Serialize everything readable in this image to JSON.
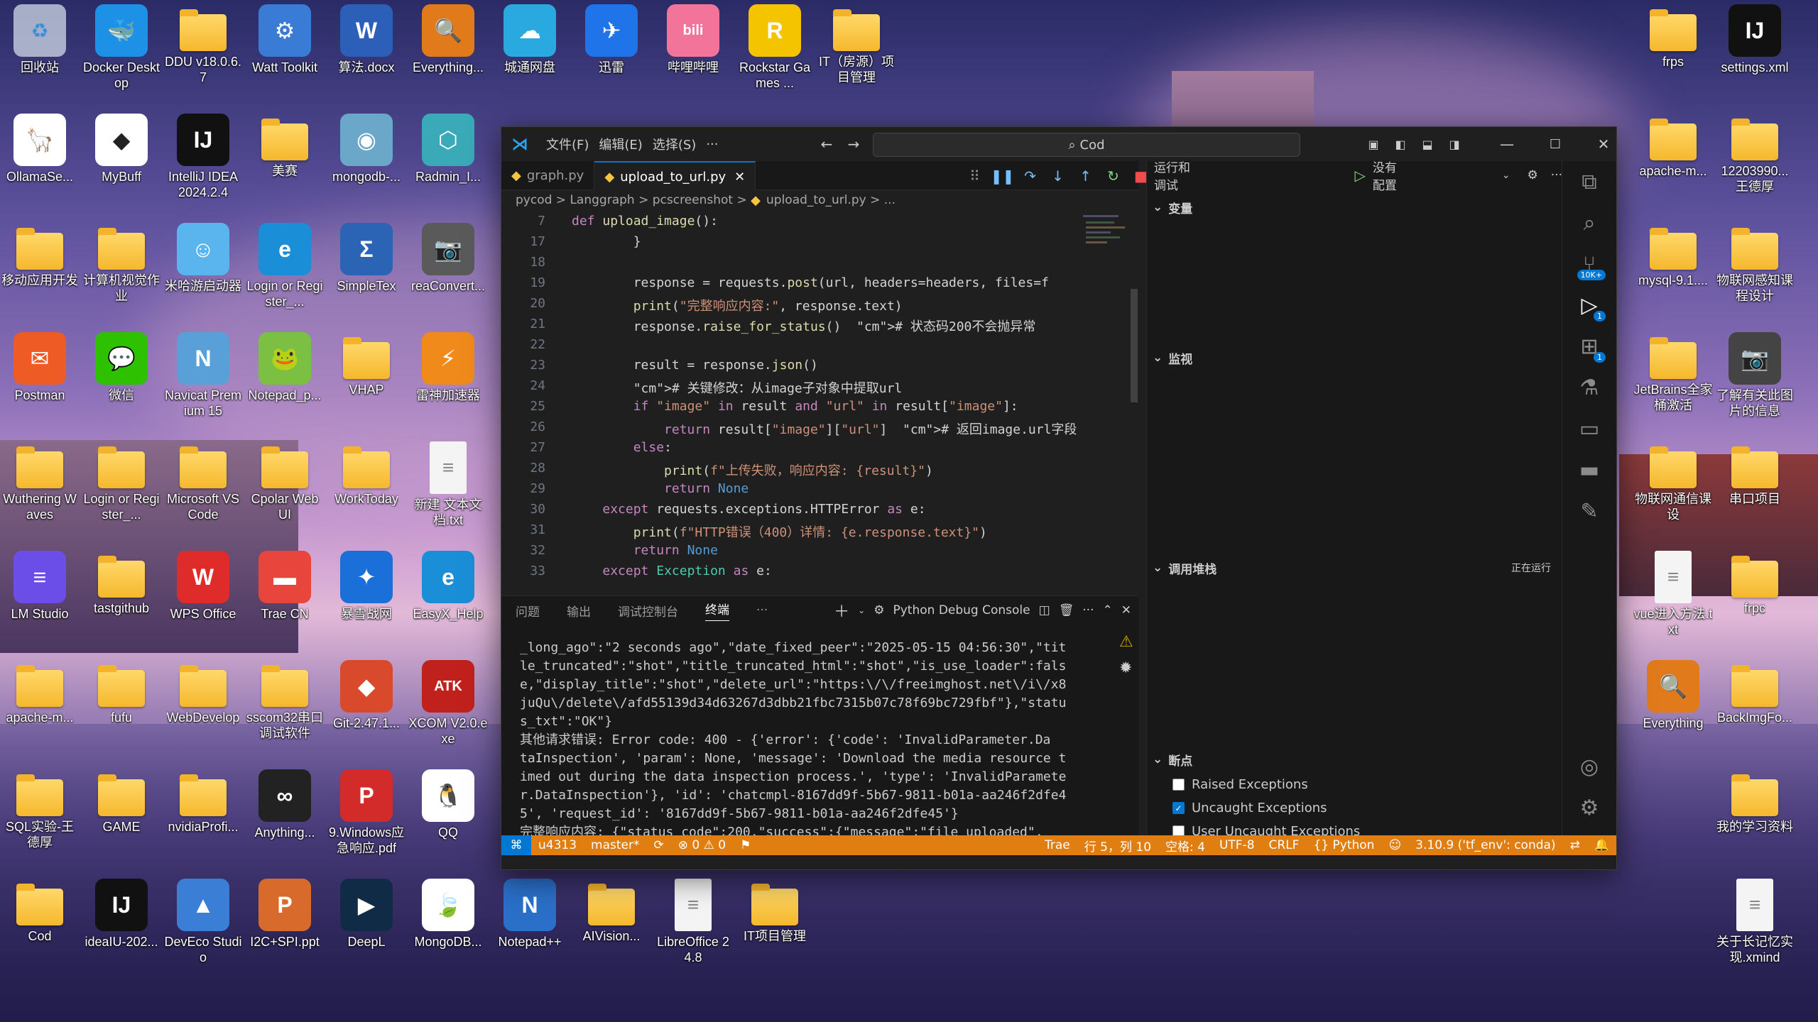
{
  "desktop": {
    "icons_left": [
      {
        "label": "回收站",
        "kind": "bin",
        "col": 0,
        "row": 0
      },
      {
        "label": "Docker Desktop",
        "kind": "app",
        "color": "#1d91e6",
        "glyph": "🐳",
        "col": 1,
        "row": 0
      },
      {
        "label": "DDU v18.0.6.7",
        "kind": "folder",
        "col": 2,
        "row": 0
      },
      {
        "label": "Watt Toolkit",
        "kind": "app",
        "color": "#3a7bd5",
        "glyph": "⚙",
        "col": 3,
        "row": 0
      },
      {
        "label": "算法.docx",
        "kind": "app",
        "color": "#2b5fb8",
        "glyph": "W",
        "col": 4,
        "row": 0
      },
      {
        "label": "Everything...",
        "kind": "app",
        "color": "#e07a1a",
        "glyph": "🔍",
        "col": 5,
        "row": 0
      },
      {
        "label": "城通网盘",
        "kind": "app",
        "color": "#2aa8e0",
        "glyph": "☁",
        "col": 6,
        "row": 0
      },
      {
        "label": "迅雷",
        "kind": "app",
        "color": "#1e74e8",
        "glyph": "✈",
        "col": 7,
        "row": 0
      },
      {
        "label": "哔哩哔哩",
        "kind": "app",
        "color": "#f2749a",
        "glyph": "bili",
        "col": 8,
        "row": 0
      },
      {
        "label": "Rockstar Games ...",
        "kind": "app",
        "color": "#f5c400",
        "glyph": "R",
        "col": 9,
        "row": 0
      },
      {
        "label": "IT（房源）项目管理",
        "kind": "folder",
        "col": 10,
        "row": 0
      },
      {
        "label": "OllamaSe...",
        "kind": "app",
        "color": "#ffffff",
        "glyph": "🦙",
        "col": 0,
        "row": 1
      },
      {
        "label": "MyBuff",
        "kind": "app",
        "color": "#ffffff",
        "glyph": "◆",
        "col": 1,
        "row": 1
      },
      {
        "label": "IntelliJ IDEA 2024.2.4",
        "kind": "app",
        "color": "#111",
        "glyph": "IJ",
        "col": 2,
        "row": 1
      },
      {
        "label": "美赛",
        "kind": "folder",
        "col": 3,
        "row": 1
      },
      {
        "label": "mongodb-...",
        "kind": "app",
        "color": "#6aa7c8",
        "glyph": "◉",
        "col": 4,
        "row": 1
      },
      {
        "label": "Radmin_I...",
        "kind": "app",
        "color": "#3aa9b8",
        "glyph": "⬡",
        "col": 5,
        "row": 1
      },
      {
        "label": "移动应用开发",
        "kind": "folder",
        "col": 0,
        "row": 2
      },
      {
        "label": "计算机视觉作业",
        "kind": "folder",
        "col": 1,
        "row": 2
      },
      {
        "label": "米哈游启动器",
        "kind": "app",
        "color": "#5ab4ee",
        "glyph": "☺",
        "col": 2,
        "row": 2
      },
      {
        "label": "Login or Register_...",
        "kind": "app",
        "color": "#1a8fd8",
        "glyph": "e",
        "col": 3,
        "row": 2
      },
      {
        "label": "SimpleTex",
        "kind": "app",
        "color": "#2b63b5",
        "glyph": "Σ",
        "col": 4,
        "row": 2
      },
      {
        "label": "reaConvert...",
        "kind": "app",
        "color": "#5a5a5a",
        "glyph": "📷",
        "col": 5,
        "row": 2
      },
      {
        "label": "Postman",
        "kind": "app",
        "color": "#ef5b25",
        "glyph": "✉",
        "col": 0,
        "row": 3
      },
      {
        "label": "微信",
        "kind": "app",
        "color": "#2dc100",
        "glyph": "💬",
        "col": 1,
        "row": 3
      },
      {
        "label": "Navicat Premium 15",
        "kind": "app",
        "color": "#5aa0d8",
        "glyph": "N",
        "col": 2,
        "row": 3
      },
      {
        "label": "Notepad_p...",
        "kind": "app",
        "color": "#7bc043",
        "glyph": "🐸",
        "col": 3,
        "row": 3
      },
      {
        "label": "VHAP",
        "kind": "folder",
        "col": 4,
        "row": 3
      },
      {
        "label": "雷神加速器",
        "kind": "app",
        "color": "#f08a1a",
        "glyph": "⚡",
        "col": 5,
        "row": 3
      },
      {
        "label": "Wuthering Waves",
        "kind": "folder",
        "col": 0,
        "row": 4
      },
      {
        "label": "Login or Register_...",
        "kind": "folder",
        "col": 1,
        "row": 4
      },
      {
        "label": "Microsoft VS Code",
        "kind": "folder",
        "col": 2,
        "row": 4
      },
      {
        "label": "Cpolar Web UI",
        "kind": "folder",
        "col": 3,
        "row": 4
      },
      {
        "label": "WorkToday",
        "kind": "folder",
        "col": 4,
        "row": 4
      },
      {
        "label": "新建 文本文档.txt",
        "kind": "doc",
        "col": 5,
        "row": 4
      },
      {
        "label": "LM Studio",
        "kind": "app",
        "color": "#6b4ee8",
        "glyph": "≡",
        "col": 0,
        "row": 5
      },
      {
        "label": "tastgithub",
        "kind": "folder",
        "col": 1,
        "row": 5
      },
      {
        "label": "WPS Office",
        "kind": "app",
        "color": "#e02b2b",
        "glyph": "W",
        "col": 2,
        "row": 5
      },
      {
        "label": "Trae CN",
        "kind": "app",
        "color": "#e8453c",
        "glyph": "▬",
        "col": 3,
        "row": 5
      },
      {
        "label": "暴雪战网",
        "kind": "app",
        "color": "#1a6fd8",
        "glyph": "✦",
        "col": 4,
        "row": 5
      },
      {
        "label": "EasyX_Help",
        "kind": "app",
        "color": "#1a8fd8",
        "glyph": "e",
        "col": 5,
        "row": 5
      },
      {
        "label": "apache-m...",
        "kind": "folder",
        "col": 0,
        "row": 6
      },
      {
        "label": "fufu",
        "kind": "folder",
        "col": 1,
        "row": 6
      },
      {
        "label": "WebDevelop",
        "kind": "folder",
        "col": 2,
        "row": 6
      },
      {
        "label": "sscom32串口调试软件",
        "kind": "folder",
        "col": 3,
        "row": 6
      },
      {
        "label": "Git-2.47.1...",
        "kind": "app",
        "color": "#d84a2b",
        "glyph": "◆",
        "col": 4,
        "row": 6
      },
      {
        "label": "XCOM V2.0.exe",
        "kind": "app",
        "color": "#c0211c",
        "glyph": "ATK",
        "col": 5,
        "row": 6
      },
      {
        "label": "SQL实验-王德厚",
        "kind": "folder",
        "col": 0,
        "row": 7
      },
      {
        "label": "GAME",
        "kind": "folder",
        "col": 1,
        "row": 7
      },
      {
        "label": "nvidiaProfi...",
        "kind": "folder",
        "col": 2,
        "row": 7
      },
      {
        "label": "Anything...",
        "kind": "app",
        "color": "#222",
        "glyph": "∞",
        "col": 3,
        "row": 7
      },
      {
        "label": "9.Windows应急响应.pdf",
        "kind": "app",
        "color": "#d32a2a",
        "glyph": "P",
        "col": 4,
        "row": 7
      },
      {
        "label": "QQ",
        "kind": "app",
        "color": "#ffffff",
        "glyph": "🐧",
        "col": 5,
        "row": 7
      },
      {
        "label": "Cod",
        "kind": "folder",
        "col": 0,
        "row": 8
      },
      {
        "label": "ideaIU-202...",
        "kind": "app",
        "color": "#111",
        "glyph": "IJ",
        "col": 1,
        "row": 8
      },
      {
        "label": "DevEco Studio",
        "kind": "app",
        "color": "#3a7fd5",
        "glyph": "▲",
        "col": 2,
        "row": 8
      },
      {
        "label": "I2C+SPI.ppt",
        "kind": "app",
        "color": "#d86a2b",
        "glyph": "P",
        "col": 3,
        "row": 8
      },
      {
        "label": "DeepL",
        "kind": "app",
        "color": "#0f2b46",
        "glyph": "▶",
        "col": 4,
        "row": 8
      },
      {
        "label": "MongoDB...",
        "kind": "app",
        "color": "#fff",
        "glyph": "🍃",
        "col": 5,
        "row": 8
      },
      {
        "label": "Notepad++",
        "kind": "app",
        "color": "#2a6fc8",
        "glyph": "N",
        "col": 6,
        "row": 8
      },
      {
        "label": "AIVision...",
        "kind": "folder",
        "col": 7,
        "row": 8
      },
      {
        "label": "LibreOffice 24.8",
        "kind": "doc",
        "col": 8,
        "row": 8
      },
      {
        "label": "IT项目管理",
        "kind": "folder",
        "col": 9,
        "row": 8
      }
    ],
    "icons_right": [
      {
        "label": "frps",
        "kind": "folder",
        "col": 0,
        "row": 0
      },
      {
        "label": "settings.xml",
        "kind": "app",
        "color": "#111",
        "glyph": "IJ",
        "col": 1,
        "row": 0
      },
      {
        "label": "apache-m...",
        "kind": "folder",
        "col": 0,
        "row": 1
      },
      {
        "label": "12203990...王德厚",
        "kind": "folder",
        "col": 1,
        "row": 1
      },
      {
        "label": "mysql-9.1....",
        "kind": "folder",
        "col": 0,
        "row": 2
      },
      {
        "label": "物联网感知课程设计",
        "kind": "folder",
        "col": 1,
        "row": 2
      },
      {
        "label": "JetBrains全家桶激活",
        "kind": "folder",
        "col": 0,
        "row": 3
      },
      {
        "label": "了解有关此图片的信息",
        "kind": "app",
        "color": "#444",
        "glyph": "📷",
        "col": 1,
        "row": 3
      },
      {
        "label": "物联网通信课设",
        "kind": "folder",
        "col": 0,
        "row": 4
      },
      {
        "label": "串口项目",
        "kind": "folder",
        "col": 1,
        "row": 4
      },
      {
        "label": "vue进入方法.txt",
        "kind": "doc",
        "col": 0,
        "row": 5
      },
      {
        "label": "frpc",
        "kind": "folder",
        "col": 1,
        "row": 5
      },
      {
        "label": "Everything",
        "kind": "app",
        "color": "#e07a1a",
        "glyph": "🔍",
        "col": 0,
        "row": 6
      },
      {
        "label": "BackImgFo...",
        "kind": "folder",
        "col": 1,
        "row": 6
      },
      {
        "label": "我的学习资料",
        "kind": "folder",
        "col": 1,
        "row": 7
      },
      {
        "label": "关于长记忆实现.xmind",
        "kind": "doc",
        "col": 1,
        "row": 8
      }
    ]
  },
  "vscode": {
    "menus": [
      "文件(F)",
      "编辑(E)",
      "选择(S)",
      "···"
    ],
    "command_center": "Cod",
    "tabs": [
      {
        "label": "graph.py",
        "active": false
      },
      {
        "label": "upload_to_url.py",
        "active": true
      }
    ],
    "breadcrumb": [
      "pycod",
      ">",
      "Langgraph",
      ">",
      "pcscreenshot",
      ">",
      "upload_to_url.py",
      ">",
      "..."
    ],
    "run_debug_title": "运行和调试",
    "run_config": "没有配置",
    "sections": {
      "variables": "变量",
      "watch": "监视",
      "callstack": "调用堆栈",
      "callstack_status": "正在运行",
      "breakpoints": "断点"
    },
    "breakpoints": [
      {
        "label": "Raised Exceptions",
        "checked": false
      },
      {
        "label": "Uncaught Exceptions",
        "checked": true
      },
      {
        "label": "User Uncaught Exceptions",
        "checked": false
      }
    ],
    "panel_tabs": [
      "问题",
      "输出",
      "调试控制台",
      "终端",
      "···"
    ],
    "panel_active": "终端",
    "terminal_name": "Python Debug Console",
    "code_lines": [
      {
        "n": "7",
        "t": "def upload_image():"
      },
      {
        "n": "17",
        "t": "        }"
      },
      {
        "n": "18",
        "t": ""
      },
      {
        "n": "19",
        "t": "        response = requests.post(url, headers=headers, files=f"
      },
      {
        "n": "20",
        "t": "        print(\"完整响应内容:\", response.text)"
      },
      {
        "n": "21",
        "t": "        response.raise_for_status()  # 状态码200不会抛异常"
      },
      {
        "n": "22",
        "t": ""
      },
      {
        "n": "23",
        "t": "        result = response.json()"
      },
      {
        "n": "24",
        "t": "        # 关键修改：从image子对象中提取url"
      },
      {
        "n": "25",
        "t": "        if \"image\" in result and \"url\" in result[\"image\"]:"
      },
      {
        "n": "26",
        "t": "            return result[\"image\"][\"url\"]  # 返回image.url字段"
      },
      {
        "n": "27",
        "t": "        else:"
      },
      {
        "n": "28",
        "t": "            print(f\"上传失败，响应内容: {result}\")"
      },
      {
        "n": "29",
        "t": "            return None"
      },
      {
        "n": "30",
        "t": "    except requests.exceptions.HTTPError as e:"
      },
      {
        "n": "31",
        "t": "        print(f\"HTTP错误（400）详情: {e.response.text}\")"
      },
      {
        "n": "32",
        "t": "        return None"
      },
      {
        "n": "33",
        "t": "    except Exception as e:"
      }
    ],
    "terminal_lines": [
      "_long_ago\":\"2 seconds ago\",\"date_fixed_peer\":\"2025-05-15 04:56:30\",\"tit",
      "le_truncated\":\"shot\",\"title_truncated_html\":\"shot\",\"is_use_loader\":fals",
      "e,\"display_title\":\"shot\",\"delete_url\":\"https:\\/\\/freeimghost.net\\/i\\/x8",
      "juQu\\/delete\\/afd55139d34d63267d3dbb21fbc7315b07c78f69bc729fbf\"},\"statu",
      "s_txt\":\"OK\"}",
      "其他请求错误: Error code: 400 - {'error': {'code': 'InvalidParameter.Da",
      "taInspection', 'param': None, 'message': 'Download the media resource t",
      "imed out during the data inspection process.', 'type': 'InvalidParamete",
      "r.DataInspection'}, 'id': 'chatcmpl-8167dd9f-5b67-9811-b01a-aa246f2dfe4",
      "5', 'request_id': '8167dd9f-5b67-9811-b01a-aa246f2dfe45'}",
      "完整响应内容: {\"status_code\":200,\"success\":{\"message\":\"file uploaded\","
    ],
    "status": {
      "remote": "⌘",
      "user": "u4313",
      "branch": "master*",
      "problems": "⊗ 0 ⚠ 0",
      "trae": "Trae",
      "position": "行 5，列 10",
      "spaces": "空格: 4",
      "encoding": "UTF-8",
      "eol": "CRLF",
      "lang": "{} Python",
      "interpreter": "3.10.9 ('tf_env': conda)"
    },
    "activity_badges": {
      "source_control": "10K+",
      "run": "1",
      "extensions": "1"
    }
  }
}
